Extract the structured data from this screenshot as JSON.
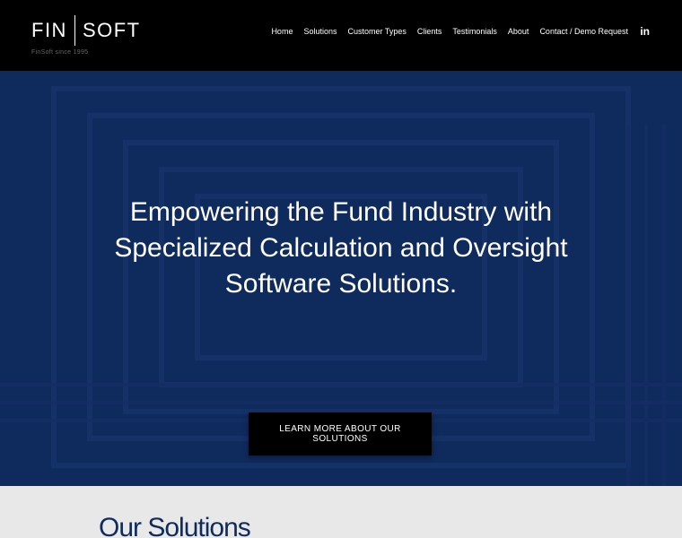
{
  "header": {
    "logo_left": "FIN",
    "logo_right": "SOFT",
    "tagline": "FinSoft since 1995",
    "nav": [
      {
        "label": "Home"
      },
      {
        "label": "Solutions"
      },
      {
        "label": "Customer Types"
      },
      {
        "label": "Clients"
      },
      {
        "label": "Testimonials"
      },
      {
        "label": "About"
      },
      {
        "label": "Contact / Demo Request"
      }
    ],
    "social_icon": "linkedin-icon",
    "social_label": "in"
  },
  "hero": {
    "title": "Empowering the Fund Industry with Specialized Calculation and Oversight Software Solutions.",
    "cta_label": "LEARN MORE ABOUT OUR SOLUTIONS",
    "background_color": "#0f2a5c"
  },
  "solutions": {
    "title": "Our Solutions"
  },
  "colors": {
    "header_bg": "#000000",
    "hero_bg": "#0f2a5c",
    "section_bg": "#e8e8e8",
    "heading_navy": "#0f2a5c"
  }
}
